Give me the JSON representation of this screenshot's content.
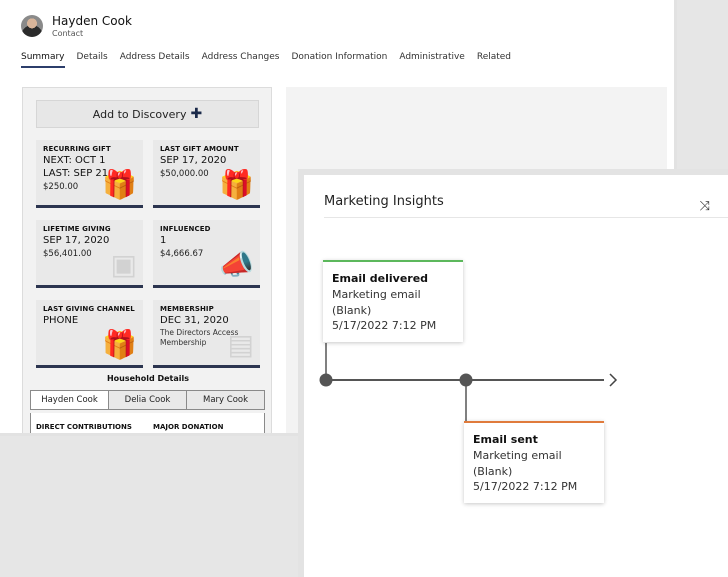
{
  "contact": {
    "name": "Hayden Cook",
    "type": "Contact"
  },
  "tabs": [
    {
      "label": "Summary",
      "active": true
    },
    {
      "label": "Details"
    },
    {
      "label": "Address Details"
    },
    {
      "label": "Address Changes"
    },
    {
      "label": "Donation Information"
    },
    {
      "label": "Administrative"
    },
    {
      "label": "Related"
    }
  ],
  "discovery": {
    "label": "Add to Discovery",
    "icon": "plus-icon"
  },
  "tiles": {
    "recurring": {
      "label": "RECURRING GIFT",
      "line1": "NEXT: OCT 1",
      "line2": "LAST: SEP 21",
      "amount": "$250.00",
      "icon": "gift-refresh-icon"
    },
    "last_gift": {
      "label": "LAST GIFT AMOUNT",
      "date": "SEP 17, 2020",
      "amount": "$50,000.00",
      "icon": "gift-refresh-icon"
    },
    "lifetime": {
      "label": "LIFETIME GIVING",
      "date": "SEP 17, 2020",
      "amount": "$56,401.00",
      "icon": "gift-box-icon"
    },
    "influenced": {
      "label": "INFLUENCED",
      "count": "1",
      "amount": "$4,666.67",
      "icon": "megaphone-icon"
    },
    "channel": {
      "label": "LAST GIVING CHANNEL",
      "value": "PHONE",
      "icon": "gift-pin-icon"
    },
    "membership": {
      "label": "MEMBERSHIP",
      "date": "DEC 31, 2020",
      "desc": "The Directors Access Membership",
      "icon": "membership-card-icon"
    }
  },
  "household": {
    "title": "Household Details",
    "members": [
      "Hayden Cook",
      "Delia Cook",
      "Mary Cook"
    ],
    "direct_label": "DIRECT CONTRIBUTIONS",
    "major_label": "MAJOR DONATION"
  },
  "insights": {
    "title": "Marketing Insights",
    "icon": "shuffle-icon",
    "events": [
      {
        "title": "Email delivered",
        "channel": "Marketing email",
        "detail": "(Blank)",
        "timestamp": "5/17/2022 7:12 PM",
        "color": "#5cb85c"
      },
      {
        "title": "Email sent",
        "channel": "Marketing email",
        "detail": "(Blank)",
        "timestamp": "5/17/2022 7:12 PM",
        "color": "#e07b3c"
      }
    ]
  },
  "colors": {
    "accent": "#2c3550",
    "delivered": "#5cb85c",
    "sent": "#e07b3c"
  }
}
